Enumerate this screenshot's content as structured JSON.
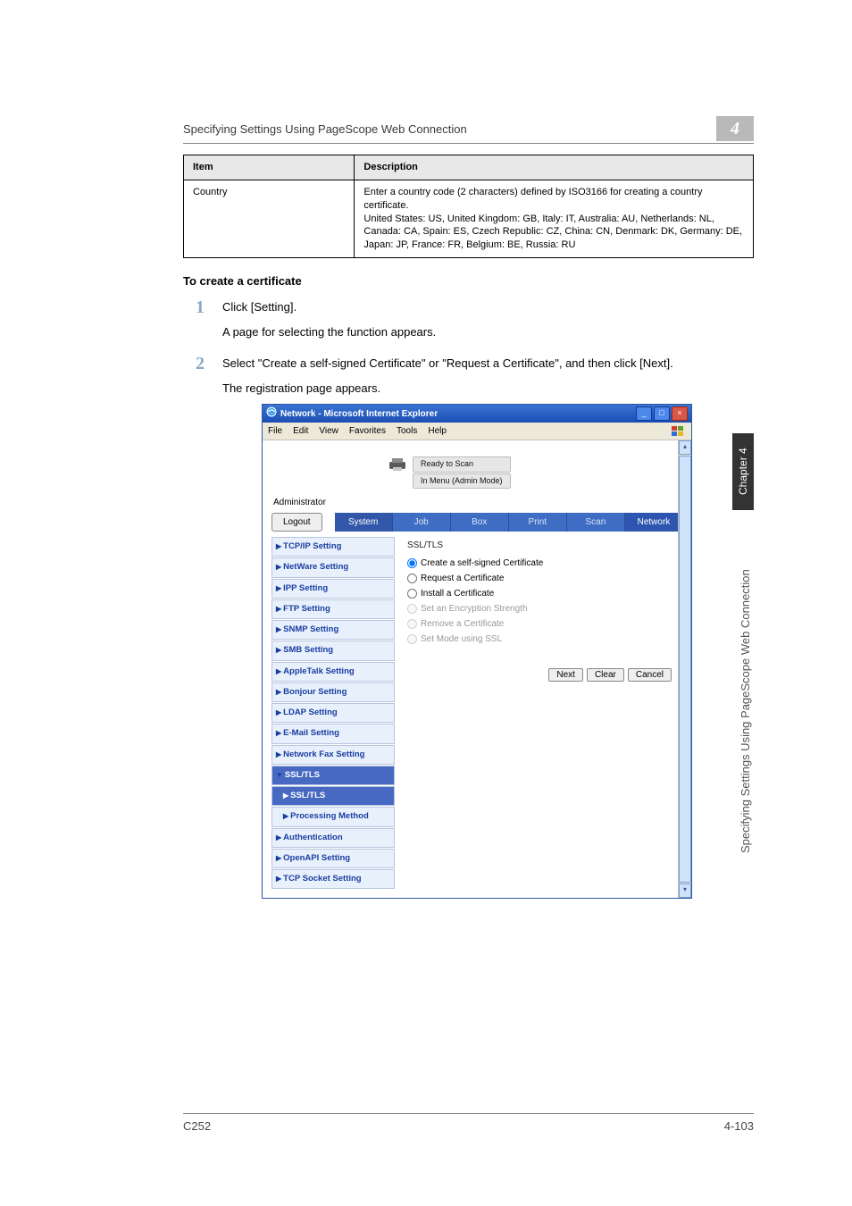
{
  "section": {
    "title": "Specifying Settings Using PageScope Web Connection",
    "number": "4"
  },
  "table": {
    "headers": {
      "item": "Item",
      "description": "Description"
    },
    "row": {
      "item": "Country",
      "desc": "Enter a country code (2 characters) defined by ISO3166 for creating a country certificate.\nUnited States: US, United Kingdom: GB, Italy: IT, Australia: AU, Netherlands: NL, Canada: CA, Spain: ES, Czech Republic: CZ, China: CN, Denmark: DK, Germany: DE, Japan: JP, France: FR, Belgium: BE, Russia: RU"
    }
  },
  "subheading": "To create a certificate",
  "steps": {
    "s1": {
      "num": "1",
      "a": "Click [Setting].",
      "b": "A page for selecting the function appears."
    },
    "s2": {
      "num": "2",
      "a": "Select \"Create a self-signed Certificate\" or \"Request a Certificate\", and then click [Next].",
      "b": "The registration page appears."
    }
  },
  "browser": {
    "title": "Network - Microsoft Internet Explorer",
    "menu": {
      "file": "File",
      "edit": "Edit",
      "view": "View",
      "favorites": "Favorites",
      "tools": "Tools",
      "help": "Help"
    },
    "status1": "Ready to Scan",
    "status2": "In Menu (Admin Mode)",
    "administrator": "Administrator",
    "logout": "Logout",
    "tabs": {
      "system": "System",
      "job": "Job",
      "box": "Box",
      "print": "Print",
      "scan": "Scan",
      "network": "Network"
    },
    "sidebar": {
      "items": [
        "TCP/IP Setting",
        "NetWare Setting",
        "IPP Setting",
        "FTP Setting",
        "SNMP Setting",
        "SMB Setting",
        "AppleTalk Setting",
        "Bonjour Setting",
        "LDAP Setting",
        "E-Mail Setting",
        "Network Fax Setting",
        "SSL/TLS",
        "SSL/TLS",
        "Processing Method",
        "Authentication",
        "OpenAPI Setting",
        "TCP Socket Setting"
      ]
    },
    "panel": {
      "title": "SSL/TLS",
      "options": {
        "o1": "Create a self-signed Certificate",
        "o2": "Request a Certificate",
        "o3": "Install a Certificate",
        "o4": "Set an Encryption Strength",
        "o5": "Remove a Certificate",
        "o6": "Set Mode using SSL"
      },
      "buttons": {
        "next": "Next",
        "clear": "Clear",
        "cancel": "Cancel"
      }
    }
  },
  "side": {
    "chapter": "Chapter 4",
    "label": "Specifying Settings Using PageScope Web Connection"
  },
  "footer": {
    "left": "C252",
    "right": "4-103"
  }
}
